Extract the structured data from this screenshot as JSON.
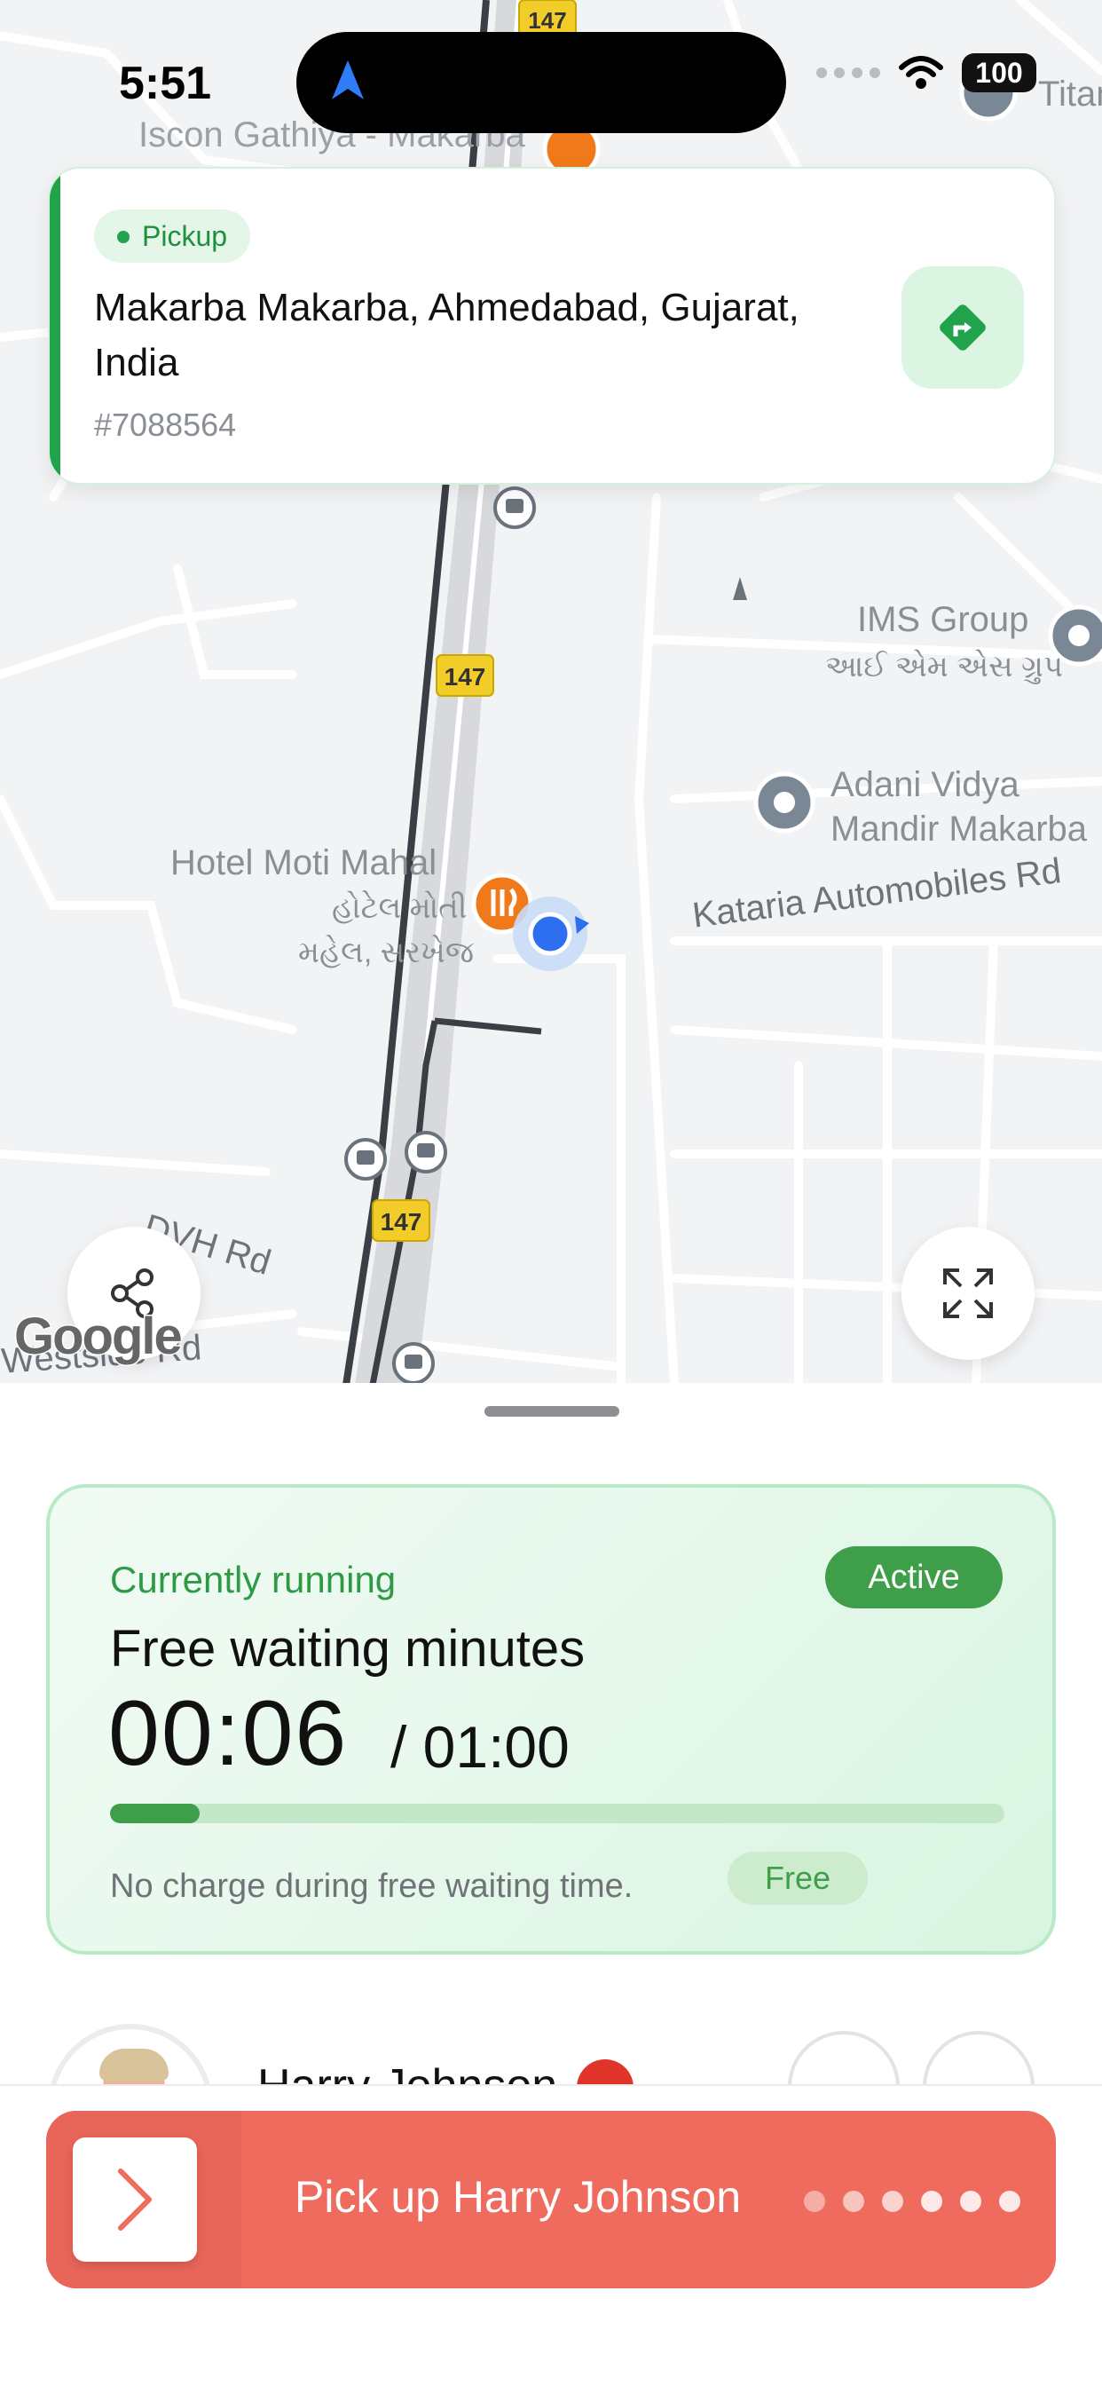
{
  "status_bar": {
    "time": "5:51",
    "battery": "100"
  },
  "map": {
    "labels": {
      "iscon": "Iscon Gathiya - Makarba",
      "ims_en": "IMS Group",
      "ims_gu": "આઈ એમ એસ ગ્રુપ",
      "adani_1": "Adani Vidya",
      "adani_2": "Mandir Makarba",
      "hotel_en": "Hotel Moti Mahal",
      "hotel_gu_1": "હોટેલ મોતી",
      "hotel_gu_2": "મહેલ, સરખેજ",
      "kataria": "Kataria Automobiles Rd",
      "dvh": "DVH Rd",
      "westside": "Westside Rd",
      "titan": "Titan",
      "highway": "147"
    },
    "google_logo": "Google"
  },
  "pickup": {
    "badge": "Pickup",
    "address": "Makarba Makarba, Ahmedabad, Gujarat, India",
    "order_id": "#7088564"
  },
  "waiting": {
    "status": "Currently running",
    "active_badge": "Active",
    "title": "Free waiting minutes",
    "elapsed": "00:06",
    "total": "/ 01:00",
    "progress_fraction": 0.1,
    "note": "No charge during free waiting time.",
    "free_badge": "Free"
  },
  "passenger": {
    "name": "Harry Johnson"
  },
  "slide_action": {
    "label": "Pick up Harry Johnson"
  },
  "colors": {
    "brand_green": "#21a34c",
    "active_green": "#3f9e4a",
    "slide_red": "#ee6b5d",
    "info_red": "#e0342a"
  }
}
